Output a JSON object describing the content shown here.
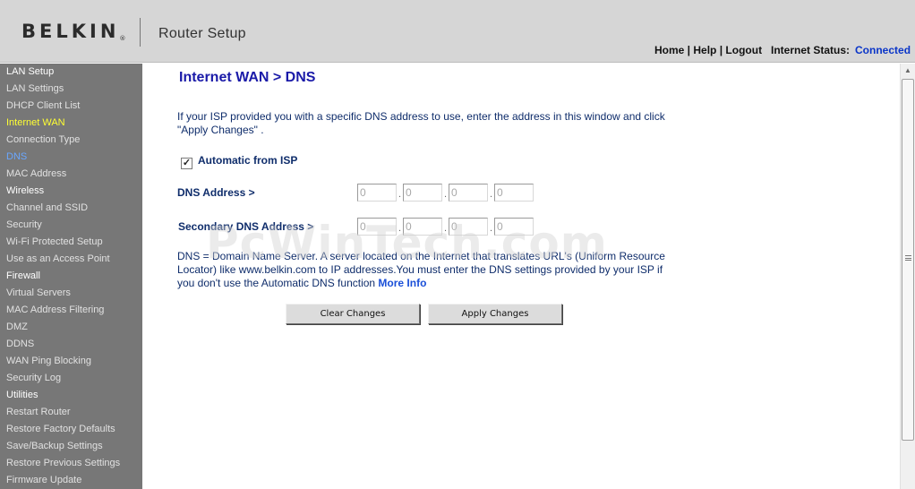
{
  "header": {
    "logo_text": "BELKIN",
    "logo_mark": "®",
    "app_title": "Router Setup",
    "nav": {
      "home": "Home",
      "help": "Help",
      "logout": "Logout",
      "separator": " | "
    },
    "internet_status_label": "Internet Status:",
    "internet_status_value": "Connected"
  },
  "sidebar": {
    "items": [
      {
        "label": "LAN Setup",
        "kind": "head"
      },
      {
        "label": "LAN Settings",
        "kind": "item"
      },
      {
        "label": "DHCP Client List",
        "kind": "item"
      },
      {
        "label": "Internet WAN",
        "kind": "active"
      },
      {
        "label": "Connection Type",
        "kind": "item"
      },
      {
        "label": "DNS",
        "kind": "current"
      },
      {
        "label": "MAC Address",
        "kind": "item"
      },
      {
        "label": "Wireless",
        "kind": "head"
      },
      {
        "label": "Channel and SSID",
        "kind": "item"
      },
      {
        "label": "Security",
        "kind": "item"
      },
      {
        "label": "Wi-Fi Protected Setup",
        "kind": "item"
      },
      {
        "label": "Use as an Access Point",
        "kind": "item"
      },
      {
        "label": "Firewall",
        "kind": "head"
      },
      {
        "label": "Virtual Servers",
        "kind": "item"
      },
      {
        "label": "MAC Address Filtering",
        "kind": "item"
      },
      {
        "label": "DMZ",
        "kind": "item"
      },
      {
        "label": "DDNS",
        "kind": "item"
      },
      {
        "label": "WAN Ping Blocking",
        "kind": "item"
      },
      {
        "label": "Security Log",
        "kind": "item"
      },
      {
        "label": "Utilities",
        "kind": "head"
      },
      {
        "label": "Restart Router",
        "kind": "item"
      },
      {
        "label": "Restore Factory Defaults",
        "kind": "item"
      },
      {
        "label": "Save/Backup Settings",
        "kind": "item"
      },
      {
        "label": "Restore Previous Settings",
        "kind": "item"
      },
      {
        "label": "Firmware Update",
        "kind": "item"
      }
    ]
  },
  "main": {
    "title": "Internet WAN > DNS",
    "intro": "If your ISP provided you with a specific DNS address to use, enter the address in this window and click \"Apply Changes\" .",
    "auto_label": "Automatic from ISP",
    "auto_checked": true,
    "check_mark": "✓",
    "dns_label": "DNS Address >",
    "dns_values": [
      "0",
      "0",
      "0",
      "0"
    ],
    "secondary_label": "Secondary DNS Address >",
    "secondary_values": [
      "0",
      "0",
      "0",
      "0"
    ],
    "octet_separator": ".",
    "description": "DNS = Domain Name Server. A server located on the Internet that translates URL's (Uniform Resource Locator) like www.belkin.com to IP addresses.You must enter the DNS settings provided by your ISP if you don't use the Automatic DNS function ",
    "more_info": "More Info",
    "clear_button": "Clear Changes",
    "apply_button": "Apply Changes"
  },
  "watermark": "PcWinTech.com",
  "colors": {
    "sidebar_bg": "#777777",
    "active_nav": "#ffff33",
    "current_nav": "#6aa7ff",
    "title_blue": "#1a1aa8",
    "status_connected": "#0a35c8"
  },
  "icons": {
    "scroll_up": "triangle-up-icon",
    "checkbox": "check-icon"
  }
}
